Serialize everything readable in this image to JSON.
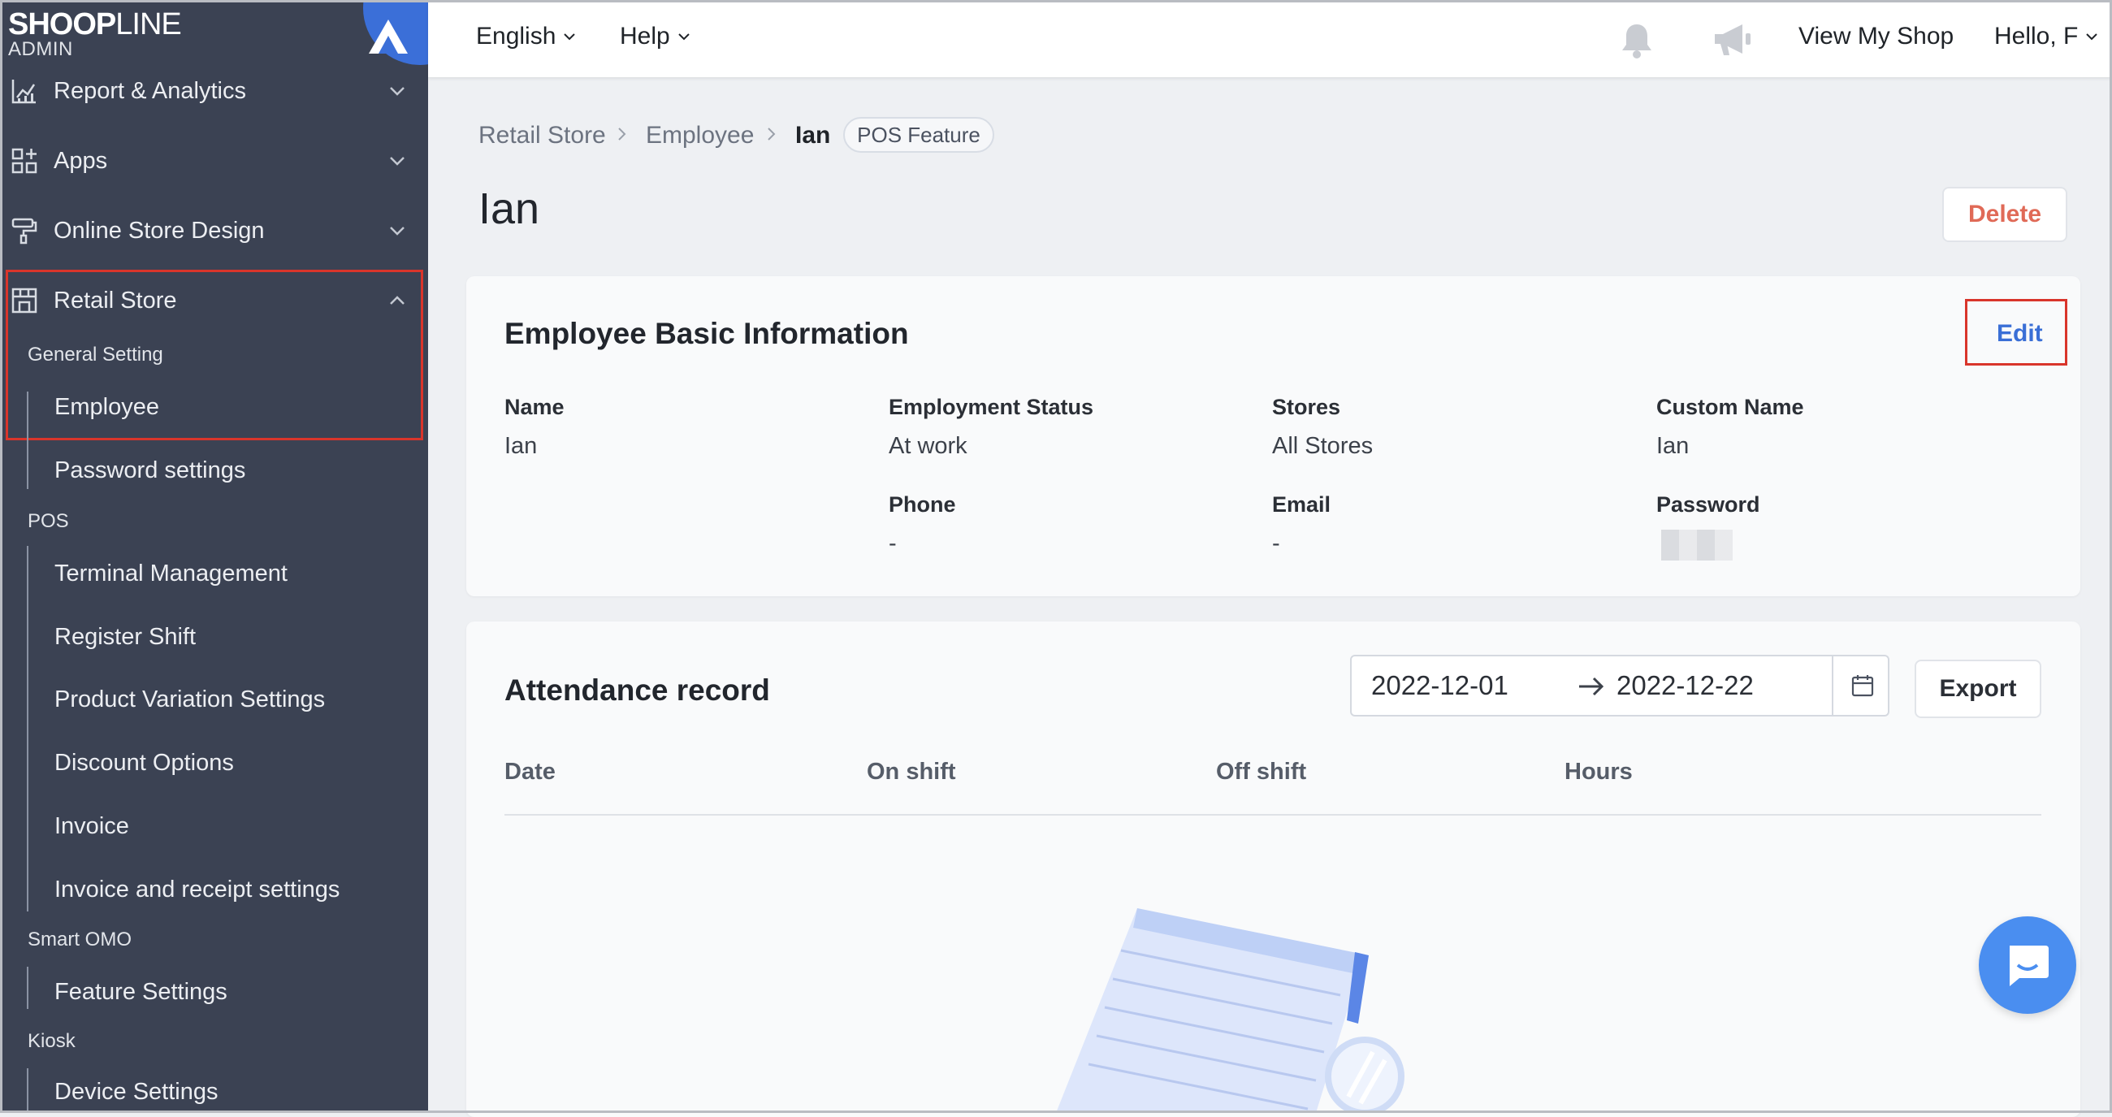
{
  "brand": {
    "logo_main": "SHOP",
    "logo_main_o": "O",
    "logo_main_rest": "LINE",
    "logo_sub": "ADMIN"
  },
  "sidebar": {
    "top_items": [
      {
        "label": "Report & Analytics",
        "icon": "chart-icon"
      },
      {
        "label": "Apps",
        "icon": "apps-icon"
      },
      {
        "label": "Online Store Design",
        "icon": "paint-roller-icon"
      },
      {
        "label": "Retail Store",
        "icon": "store-icon"
      }
    ],
    "groups": [
      {
        "label": "General Setting",
        "items": [
          "Employee",
          "Password settings"
        ]
      },
      {
        "label": "POS",
        "items": [
          "Terminal Management",
          "Register Shift",
          "Product Variation Settings",
          "Discount Options",
          "Invoice",
          "Invoice and receipt settings"
        ]
      },
      {
        "label": "Smart OMO",
        "items": [
          "Feature Settings"
        ]
      },
      {
        "label": "Kiosk",
        "items": [
          "Device Settings"
        ]
      }
    ]
  },
  "topbar": {
    "language": "English",
    "help": "Help",
    "view_shop": "View My Shop",
    "greeting": "Hello, F"
  },
  "breadcrumb": {
    "items": [
      "Retail Store",
      "Employee",
      "Ian"
    ],
    "tag": "POS Feature"
  },
  "page": {
    "title": "Ian",
    "delete_label": "Delete"
  },
  "basic_info": {
    "title": "Employee Basic Information",
    "edit_label": "Edit",
    "fields": [
      {
        "label": "Name",
        "value": "Ian"
      },
      {
        "label": "Employment Status",
        "value": "At work"
      },
      {
        "label": "Stores",
        "value": "All Stores"
      },
      {
        "label": "Custom Name",
        "value": "Ian"
      },
      {
        "label": "Phone",
        "value": "-"
      },
      {
        "label": "Email",
        "value": "-"
      },
      {
        "label": "Password",
        "value": ""
      }
    ]
  },
  "attendance": {
    "title": "Attendance record",
    "date_start": "2022-12-01",
    "date_end": "2022-12-22",
    "export_label": "Export",
    "columns": [
      "Date",
      "On shift",
      "Off shift",
      "Hours"
    ]
  },
  "colors": {
    "sidebar_bg": "#3b4253",
    "highlight_red": "#d9352b",
    "link_blue": "#3a6fd6",
    "delete_red": "#e06a57",
    "chat_blue": "#4a8ef0"
  }
}
